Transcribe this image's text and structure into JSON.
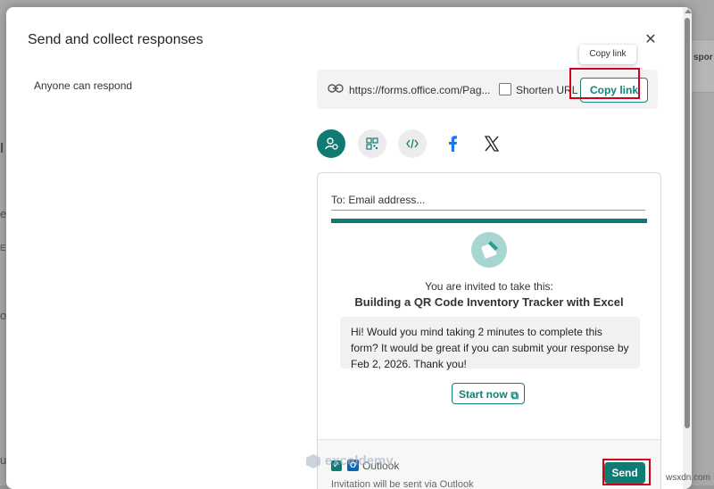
{
  "background": {
    "right_label": "spor",
    "left_marks": [
      "l",
      "e",
      "E",
      "o",
      "u"
    ]
  },
  "dialog": {
    "title": "Send and collect responses",
    "close_icon": "close-icon",
    "anyone_label": "Anyone can respond",
    "link": {
      "url": "https://forms.office.com/Pag...",
      "shorten_label": "Shorten URL",
      "shorten_checked": false,
      "copy_label": "Copy link",
      "tooltip": "Copy link"
    },
    "share_icons": [
      "invite-people-icon",
      "qr-code-icon",
      "embed-code-icon",
      "facebook-icon",
      "x-icon"
    ],
    "email": {
      "to_placeholder": "To: Email address...",
      "invited_text": "You are invited to take this:",
      "form_title": "Building a QR Code Inventory Tracker with Excel",
      "message": "Hi! Would you mind taking 2 minutes to complete this form? It would be great if you can submit your response by Feb 2, 2026. Thank you!",
      "start_label": "Start now",
      "outlook_label": "Outlook",
      "outlook_checked": true,
      "invite_note": "Invitation will be sent via Outlook",
      "send_label": "Send"
    }
  },
  "watermark": "exceldemy",
  "site_mark": "wsxdn.com",
  "colors": {
    "accent": "#0f7b73",
    "highlight": "#d0021b",
    "facebook": "#1877f2"
  }
}
